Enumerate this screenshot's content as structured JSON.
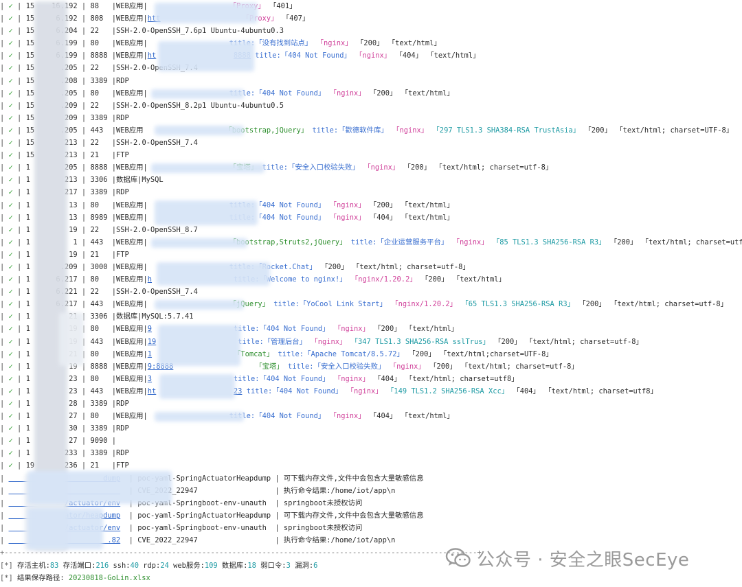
{
  "scan_rows": [
    {
      "ip": "15",
      "ip_end": "16.192",
      "port": "88",
      "service": "|WEB应用|",
      "url": "",
      "tags": [
        {
          "t": "「Proxy」",
          "c": "red"
        },
        {
          "t": "「401」",
          "c": "dark"
        }
      ]
    },
    {
      "ip": "15",
      "ip_end": "6.192",
      "port": "808",
      "service": "|WEB应用|",
      "url": "htt",
      "tags": [
        {
          "t": "「Proxy」",
          "c": "red"
        },
        {
          "t": "「407」",
          "c": "dark"
        }
      ]
    },
    {
      "ip": "15",
      "ip_end": "6.204",
      "port": "22",
      "service": "|SSH-2.0-OpenSSH_7.6p1 Ubuntu-4ubuntu0.3",
      "url": "",
      "tags": []
    },
    {
      "ip": "15",
      "ip_end": "6.199",
      "port": "80",
      "service": "|WEB应用|",
      "url": "",
      "tags": [
        {
          "t": "title:「没有找到站点」",
          "c": "blue"
        },
        {
          "t": "「nginx」",
          "c": "red"
        },
        {
          "t": "「200」",
          "c": "dark"
        },
        {
          "t": "「text/html」",
          "c": "dark"
        }
      ]
    },
    {
      "ip": "15",
      "ip_end": "6.199",
      "port": "8888",
      "service": "|WEB应用|",
      "url": "ht",
      "url2": "8888",
      "tags": [
        {
          "t": "title:「404 Not Found」",
          "c": "blue"
        },
        {
          "t": "「nginx」",
          "c": "red"
        },
        {
          "t": "「404」",
          "c": "dark"
        },
        {
          "t": "「text/html」",
          "c": "dark"
        }
      ]
    },
    {
      "ip": "15",
      "ip_end": ".205",
      "port": "22",
      "service": "|SSH-2.0-OpenSSH_7.4",
      "url": "",
      "tags": []
    },
    {
      "ip": "15",
      "ip_end": ".208",
      "port": "3389",
      "service": "|RDP",
      "url": "",
      "tags": []
    },
    {
      "ip": "15",
      "ip_end": ".205",
      "port": "80",
      "service": "|WEB应用|",
      "url": "",
      "tags": [
        {
          "t": "title:「404 Not Found」",
          "c": "blue"
        },
        {
          "t": "「nginx」",
          "c": "red"
        },
        {
          "t": "「200」",
          "c": "dark"
        },
        {
          "t": "「text/html」",
          "c": "dark"
        }
      ]
    },
    {
      "ip": "15",
      "ip_end": ".209",
      "port": "22",
      "service": "|SSH-2.0-OpenSSH_8.2p1 Ubuntu-4ubuntu0.5",
      "url": "",
      "tags": []
    },
    {
      "ip": "15",
      "ip_end": "209",
      "port": "3389",
      "service": "|RDP",
      "url": "",
      "tags": []
    },
    {
      "ip": "15",
      "ip_end": ".205",
      "port": "443",
      "service": "|WEB应用",
      "url": "",
      "tags": [
        {
          "t": "「bootstrap,jQuery」",
          "c": "green"
        },
        {
          "t": "title:「歡德软件库」",
          "c": "blue"
        },
        {
          "t": "「nginx」",
          "c": "red"
        },
        {
          "t": "「297 TLS1.3 SHA384-RSA TrustAsia」",
          "c": "cyan"
        },
        {
          "t": "「200」",
          "c": "dark"
        },
        {
          "t": "「text/html; charset=UTF-8」",
          "c": "dark"
        }
      ]
    },
    {
      "ip": "15",
      "ip_end": "213",
      "port": "22",
      "service": "|SSH-2.0-OpenSSH_7.4",
      "url": "",
      "tags": []
    },
    {
      "ip": "15",
      "ip_end": "213",
      "port": "21",
      "service": "|FTP",
      "url": "",
      "tags": []
    },
    {
      "ip": "1",
      "ip_end": "205",
      "port": "8888",
      "service": "|WEB应用|",
      "url": "",
      "tags": [
        {
          "t": "「宝塔」",
          "c": "green"
        },
        {
          "t": "title:「安全入口校验失败」",
          "c": "blue"
        },
        {
          "t": "「nginx」",
          "c": "red"
        },
        {
          "t": "「200」",
          "c": "dark"
        },
        {
          "t": "「text/html; charset=utf-8」",
          "c": "dark"
        }
      ]
    },
    {
      "ip": "1",
      "ip_end": "213",
      "port": "3306",
      "service": "|数据库|MySQL",
      "url": "",
      "tags": []
    },
    {
      "ip": "1",
      "ip_end": "217",
      "port": "3389",
      "service": "|RDP",
      "url": "",
      "tags": []
    },
    {
      "ip": "1",
      "ip_end": "13",
      "port": "80",
      "service": "|WEB应用|",
      "url": "",
      "tags": [
        {
          "t": "title:「404 Not Found」",
          "c": "blue"
        },
        {
          "t": "「nginx」",
          "c": "red"
        },
        {
          "t": "「200」",
          "c": "dark"
        },
        {
          "t": "「text/html」",
          "c": "dark"
        }
      ]
    },
    {
      "ip": "1",
      "ip_end": "13",
      "port": "8989",
      "service": "|WEB应用|",
      "url": "",
      "tags": [
        {
          "t": "title:「404 Not Found」",
          "c": "blue"
        },
        {
          "t": "「nginx」",
          "c": "red"
        },
        {
          "t": "「404」",
          "c": "dark"
        },
        {
          "t": "「text/html」",
          "c": "dark"
        }
      ]
    },
    {
      "ip": "1",
      "ip_end": "19",
      "port": "22",
      "service": "|SSH-2.0-OpenSSH_8.7",
      "url": "",
      "tags": []
    },
    {
      "ip": "1",
      "ip_end": "1",
      "port": "443",
      "service": "|WEB应用|",
      "url": "",
      "tags": [
        {
          "t": "「bootstrap,Struts2,jQuery」",
          "c": "green"
        },
        {
          "t": "title:「企业运营服务平台」",
          "c": "blue"
        },
        {
          "t": "「nginx」",
          "c": "red"
        },
        {
          "t": "「85 TLS1.3 SHA256-RSA R3」",
          "c": "cyan"
        },
        {
          "t": "「200」",
          "c": "dark"
        },
        {
          "t": "「text/html; charset=utf-8」",
          "c": "dark"
        }
      ]
    },
    {
      "ip": "1",
      "ip_end": "19",
      "port": "21",
      "service": "|FTP",
      "url": "",
      "tags": []
    },
    {
      "ip": "1",
      "ip_end": ".209",
      "port": "3000",
      "service": "|WEB应用|",
      "url": "",
      "tags": [
        {
          "t": "title:「Rocket.Chat」",
          "c": "blue"
        },
        {
          "t": "「200」",
          "c": "dark"
        },
        {
          "t": "「text/html; charset=utf-8」",
          "c": "dark"
        }
      ]
    },
    {
      "ip": "1",
      "ip_end": "6.217",
      "port": "80",
      "service": "|WEB应用|",
      "url": "h",
      "tags": [
        {
          "t": "title:「Welcome to nginx!」",
          "c": "blue"
        },
        {
          "t": "「nginx/1.20.2」",
          "c": "red"
        },
        {
          "t": "「200」",
          "c": "dark"
        },
        {
          "t": "「text/html」",
          "c": "dark"
        }
      ]
    },
    {
      "ip": "1",
      "ip_end": "6.221",
      "port": "22",
      "service": "|SSH-2.0-OpenSSH_7.4",
      "url": "",
      "tags": []
    },
    {
      "ip": "1",
      "ip_end": "6.217",
      "port": "443",
      "service": "|WEB应用|",
      "url": "",
      "tags": [
        {
          "t": "「jQuery」",
          "c": "green"
        },
        {
          "t": "title:「YoCool Link Start」",
          "c": "blue"
        },
        {
          "t": "「nginx/1.20.2」",
          "c": "red"
        },
        {
          "t": "「65 TLS1.3 SHA256-RSA R3」",
          "c": "cyan"
        },
        {
          "t": "「200」",
          "c": "dark"
        },
        {
          "t": "「text/html; charset=utf-8」",
          "c": "dark"
        }
      ]
    },
    {
      "ip": "1",
      "ip_end": "21",
      "port": "3306",
      "service": "|数据库|MySQL:5.7.41",
      "url": "",
      "tags": []
    },
    {
      "ip": "1",
      "ip_end": "19",
      "port": "80",
      "service": "|WEB应用|",
      "url": "9",
      "tags": [
        {
          "t": "title:「404 Not Found」",
          "c": "blue"
        },
        {
          "t": "「nginx」",
          "c": "red"
        },
        {
          "t": "「200」",
          "c": "dark"
        },
        {
          "t": "「text/html」",
          "c": "dark"
        }
      ]
    },
    {
      "ip": "1",
      "ip_end": "19",
      "port": "443",
      "service": "|WEB应用|",
      "url": "19",
      "tags": [
        {
          "t": "title:「管理后台」",
          "c": "blue"
        },
        {
          "t": "「nginx」",
          "c": "red"
        },
        {
          "t": "「347 TLS1.3 SHA256-RSA sslTrus」",
          "c": "cyan"
        },
        {
          "t": "「200」",
          "c": "dark"
        },
        {
          "t": "「text/html; charset=utf-8」",
          "c": "dark"
        }
      ]
    },
    {
      "ip": "1",
      "ip_end": "21",
      "port": "80",
      "service": "|WEB应用|",
      "url": "1",
      "tags": [
        {
          "t": "「Tomcat」",
          "c": "green"
        },
        {
          "t": "title:「Apache Tomcat/8.5.72」",
          "c": "blue"
        },
        {
          "t": "「200」",
          "c": "dark"
        },
        {
          "t": "「text/html;charset=UTF-8」",
          "c": "dark"
        }
      ]
    },
    {
      "ip": "1",
      "ip_end": "19",
      "port": "8888",
      "service": "|WEB应用|",
      "url": "9:8888",
      "tags": [
        {
          "t": "「宝塔」",
          "c": "green"
        },
        {
          "t": "title:「安全入口校验失败」",
          "c": "blue"
        },
        {
          "t": "「nginx」",
          "c": "red"
        },
        {
          "t": "「200」",
          "c": "dark"
        },
        {
          "t": "「text/html; charset=utf-8」",
          "c": "dark"
        }
      ]
    },
    {
      "ip": "1",
      "ip_end": "23",
      "port": "80",
      "service": "|WEB应用|",
      "url": "3",
      "tags": [
        {
          "t": "title:「404 Not Found」",
          "c": "blue"
        },
        {
          "t": "「nginx」",
          "c": "red"
        },
        {
          "t": "「404」",
          "c": "dark"
        },
        {
          "t": "「text/html; charset=utf8」",
          "c": "dark"
        }
      ]
    },
    {
      "ip": "1",
      "ip_end": "23",
      "port": "443",
      "service": "|WEB应用|",
      "url": "ht",
      "url2": "23",
      "tags": [
        {
          "t": "title:「404 Not Found」",
          "c": "blue"
        },
        {
          "t": "「nginx」",
          "c": "red"
        },
        {
          "t": "「149 TLS1.2 SHA256-RSA Xcc」",
          "c": "cyan"
        },
        {
          "t": "「404」",
          "c": "dark"
        },
        {
          "t": "「text/html; charset=utf8」",
          "c": "dark"
        }
      ]
    },
    {
      "ip": "1",
      "ip_end": "28",
      "port": "3389",
      "service": "|RDP",
      "url": "",
      "tags": []
    },
    {
      "ip": "1",
      "ip_end": "27",
      "port": "80",
      "service": "|WEB应用|",
      "url": "",
      "tags": [
        {
          "t": "title:「404 Not Found」",
          "c": "blue"
        },
        {
          "t": "「nginx」",
          "c": "red"
        },
        {
          "t": "「404」",
          "c": "dark"
        },
        {
          "t": "「text/html」",
          "c": "dark"
        }
      ]
    },
    {
      "ip": "1",
      "ip_end": "30",
      "port": "3389",
      "service": "|RDP",
      "url": "",
      "tags": []
    },
    {
      "ip": "1",
      "ip_end": "27",
      "port": "9090",
      "service": "|",
      "url": "",
      "tags": []
    },
    {
      "ip": "1",
      "ip_end": "233",
      "port": "3389",
      "service": "|RDP",
      "url": "",
      "tags": []
    },
    {
      "ip": "19",
      "ip_end": "236",
      "port": "21",
      "service": "|FTP",
      "url": "",
      "tags": []
    }
  ],
  "vuln_rows": [
    {
      "target": "dump",
      "poc": "poc-yaml-SpringActuatorHeapdump",
      "detail": "可下载内存文件,文件中会包含大量敏感信息"
    },
    {
      "target": "",
      "poc": "CVE_2022_22947",
      "detail": "执行命令结果:/home/iot/app\\n"
    },
    {
      "target": "82/actuator/env",
      "poc": "poc-yaml-Springboot-env-unauth",
      "detail": "springboot未授权访问"
    },
    {
      "target": "82/actuator/heapdump",
      "poc": "poc-yaml-SpringActuatorHeapdump",
      "detail": "可下载内存文件,文件中会包含大量敏感信息"
    },
    {
      "target": "81/actuator/env",
      "poc": "poc-yaml-Springboot-env-unauth",
      "detail": "springboot未授权访问"
    },
    {
      "target": ".82",
      "poc": "CVE_2022_22947",
      "detail": "执行命令结果:/home/iot/app\\n"
    }
  ],
  "summary": {
    "line1_prefix": "[*] ",
    "alive_label": "存活主机:",
    "alive": "83",
    "ports_label": " 存活端口:",
    "ports": "216",
    "ssh_label": " ssh:",
    "ssh": "40",
    "rdp_label": " rdp:",
    "rdp": "24",
    "web_label": " web服务:",
    "web": "109",
    "db_label": " 数据库:",
    "db": "18",
    "weak_label": " 弱口令:",
    "weak": "3",
    "vuln_label": " 漏洞:",
    "vuln": "6",
    "line2_prefix": "[*] ",
    "path_label": "结果保存路径: ",
    "path": "20230818-GoLin.xlsx"
  },
  "watermark": {
    "text": "公众号 · 安全之眼SecEye",
    "icon": "wechat-icon"
  },
  "colors": {
    "ok": "#2e9d2e",
    "url": "#2a63c9",
    "tag_red": "#d0409a",
    "tag_blue": "#3a6fd0",
    "tag_green": "#2e8f2e",
    "tag_cyan": "#1c9aa3"
  }
}
